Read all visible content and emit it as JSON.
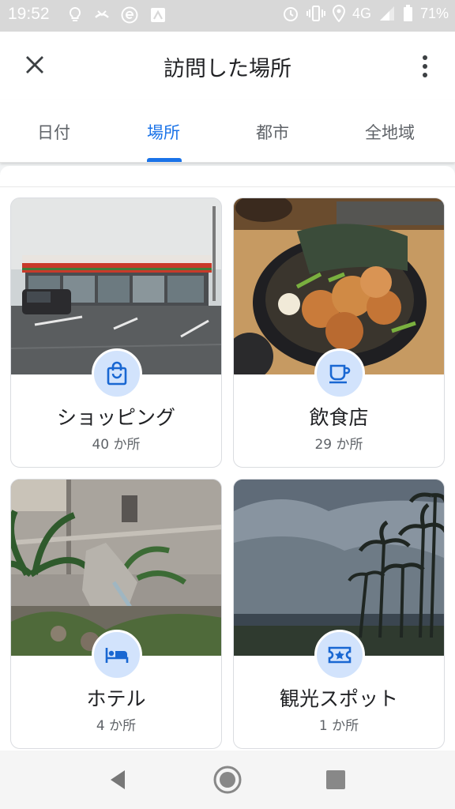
{
  "status_bar": {
    "time": "19:52",
    "network": "4G",
    "battery": "71%",
    "left_icons": [
      "lightbulb-icon",
      "missed-call-icon",
      "e-app-icon",
      "gallery-icon"
    ],
    "right_icons": [
      "alarm-icon",
      "vibrate-icon",
      "location-icon",
      "signal-icon",
      "battery-icon"
    ]
  },
  "app_bar": {
    "title": "訪問した場所",
    "close_icon": "close-icon",
    "menu_icon": "more-vert-icon"
  },
  "tabs": [
    {
      "label": "日付",
      "active": false
    },
    {
      "label": "場所",
      "active": true
    },
    {
      "label": "都市",
      "active": false
    },
    {
      "label": "全地域",
      "active": false
    }
  ],
  "categories": [
    {
      "label": "ショッピング",
      "count": "40 か所",
      "icon": "shopping-bag-icon",
      "photo": "convenience-store-photo"
    },
    {
      "label": "飲食店",
      "count": "29 か所",
      "icon": "coffee-cup-icon",
      "photo": "ramen-bowl-photo"
    },
    {
      "label": "ホテル",
      "count": "4 か所",
      "icon": "bed-icon",
      "photo": "hotel-garden-photo"
    },
    {
      "label": "観光スポット",
      "count": "1 か所",
      "icon": "ticket-icon",
      "photo": "palm-beach-photo"
    }
  ],
  "nav_bar": {
    "icons": [
      "back-icon",
      "home-icon",
      "recents-icon"
    ]
  },
  "colors": {
    "accent": "#1a73e8",
    "badge_bg": "#d2e3fc",
    "icon_blue": "#1967d2"
  }
}
